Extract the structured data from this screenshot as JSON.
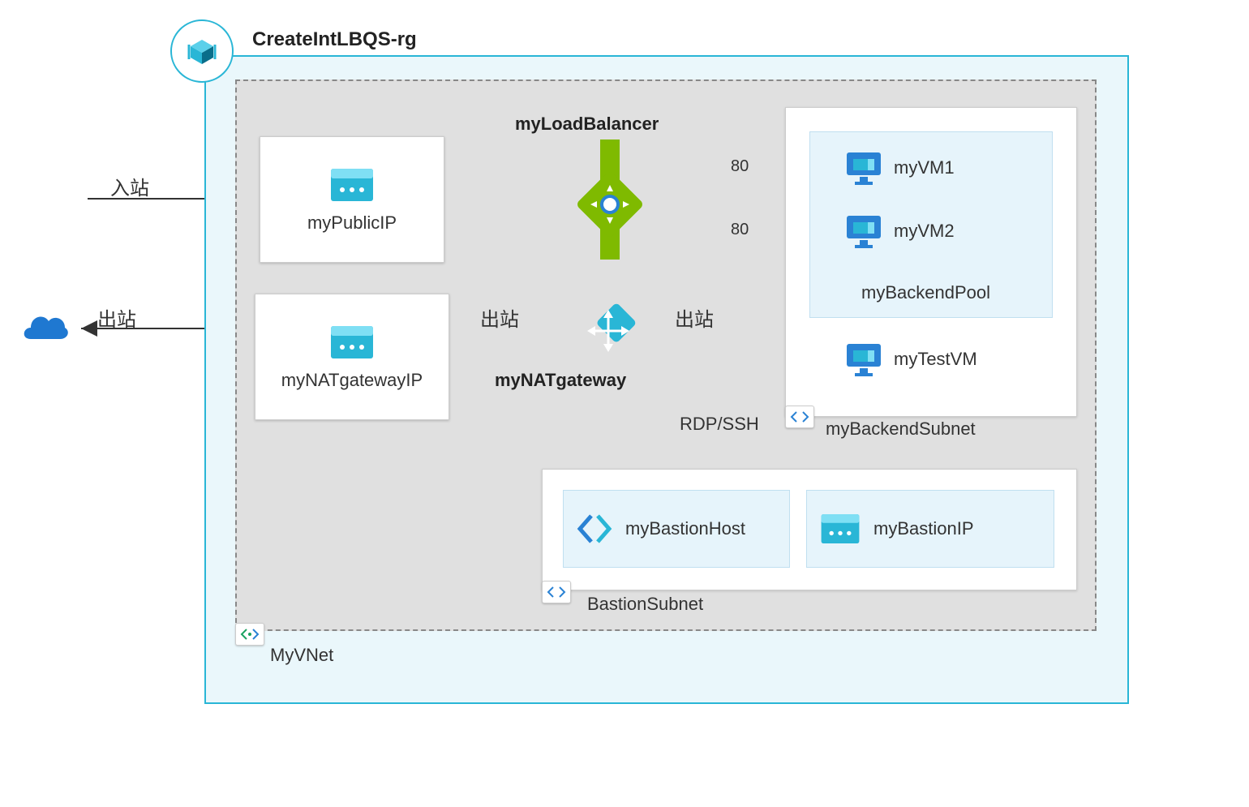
{
  "resource_group": {
    "title": "CreateIntLBQS-rg"
  },
  "vnet": {
    "label": "MyVNet"
  },
  "backend_subnet": {
    "label": "myBackendSubnet",
    "pool_label": "myBackendPool",
    "vms": [
      "myVM1",
      "myVM2"
    ],
    "test_vm": "myTestVM"
  },
  "bastion_subnet": {
    "label": "BastionSubnet",
    "host": "myBastionHost",
    "ip": "myBastionIP"
  },
  "public_ip_card": "myPublicIP",
  "nat_ip_card": "myNATgatewayIP",
  "load_balancer": {
    "label": "myLoadBalancer",
    "ports": [
      "80",
      "80"
    ]
  },
  "nat_gateway": {
    "label": "myNATgateway"
  },
  "arrows": {
    "inbound": "入站",
    "outbound": "出站",
    "rdp_ssh": "RDP/SSH"
  }
}
